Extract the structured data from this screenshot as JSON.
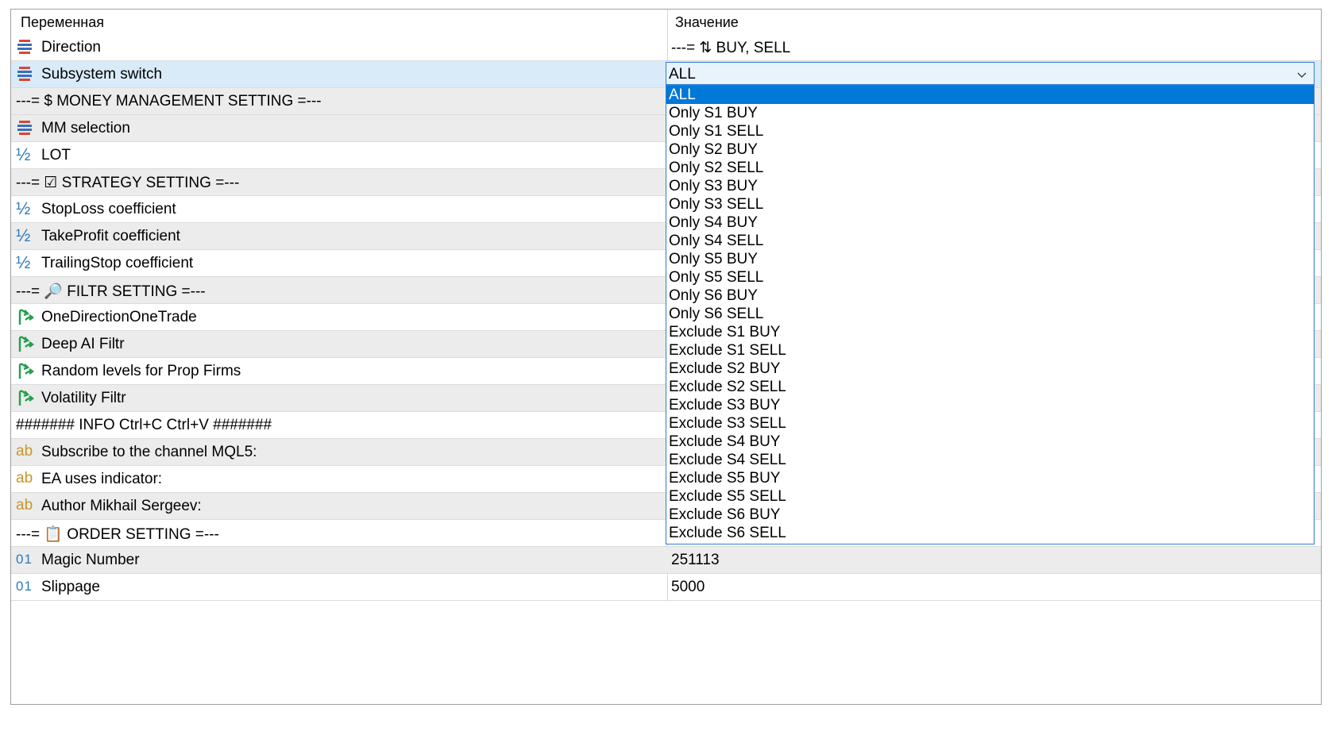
{
  "header": {
    "variable": "Переменная",
    "value": "Значение"
  },
  "rows": [
    {
      "icon": "enum",
      "name": "Direction",
      "value": "---= ⇅ BUY, SELL"
    },
    {
      "icon": "enum",
      "name": "Subsystem switch",
      "value": "ALL"
    },
    {
      "icon": "none",
      "name": "---= $ MONEY MANAGEMENT SETTING =---",
      "value": ""
    },
    {
      "icon": "enum",
      "name": "MM selection",
      "value": ""
    },
    {
      "icon": "half",
      "name": "LOT",
      "value": ""
    },
    {
      "icon": "none",
      "name": "---= ☑ STRATEGY SETTING =---",
      "value": ""
    },
    {
      "icon": "half",
      "name": "StopLoss coefficient",
      "value": ""
    },
    {
      "icon": "half",
      "name": "TakeProfit coefficient",
      "value": ""
    },
    {
      "icon": "half",
      "name": "TrailingStop coefficient",
      "value": ""
    },
    {
      "icon": "none",
      "name": "---= 🔎 FILTR SETTING =---",
      "value": ""
    },
    {
      "icon": "bool",
      "name": "OneDirectionOneTrade",
      "value": ""
    },
    {
      "icon": "bool",
      "name": "Deep AI Filtr",
      "value": ""
    },
    {
      "icon": "bool",
      "name": "Random levels for Prop Firms",
      "value": ""
    },
    {
      "icon": "bool",
      "name": "Volatility Filtr",
      "value": ""
    },
    {
      "icon": "none",
      "name": "####### INFO Ctrl+C Ctrl+V #######",
      "value": ""
    },
    {
      "icon": "ab",
      "name": "Subscribe to the channel MQL5:",
      "value": ""
    },
    {
      "icon": "ab",
      "name": "EA uses indicator:",
      "value": ""
    },
    {
      "icon": "ab",
      "name": "Author Mikhail Sergeev:",
      "value": ""
    },
    {
      "icon": "none",
      "name": "---= 📋 ORDER SETTING =---",
      "value": ""
    },
    {
      "icon": "num",
      "name": "Magic Number",
      "value": "251113"
    },
    {
      "icon": "num",
      "name": "Slippage",
      "value": "5000"
    }
  ],
  "dropdown": {
    "selected": "ALL",
    "options": [
      "ALL",
      "Only S1 BUY",
      "Only S1 SELL",
      "Only S2 BUY",
      "Only S2 SELL",
      "Only S3 BUY",
      "Only S3 SELL",
      "Only S4 BUY",
      "Only S4 SELL",
      "Only S5 BUY",
      "Only S5 SELL",
      "Only S6 BUY",
      "Only S6 SELL",
      "Exclude S1 BUY",
      "Exclude S1 SELL",
      "Exclude S2 BUY",
      "Exclude S2 SELL",
      "Exclude S3 BUY",
      "Exclude S3 SELL",
      "Exclude S4 BUY",
      "Exclude S4 SELL",
      "Exclude S5 BUY",
      "Exclude S5 SELL",
      "Exclude S6 BUY",
      "Exclude S6 SELL"
    ]
  },
  "icons": {
    "enum": "enum-list-icon",
    "half": "fraction-icon",
    "bool": "boolean-arrow-icon",
    "ab": "string-icon",
    "num": "integer-icon"
  },
  "colors": {
    "selection": "#0078d7",
    "row_selected": "#d9ebf9",
    "row_alt": "#ececec",
    "bool_icon": "#22a04a",
    "enum_icon": "#d9453a",
    "num_icon": "#2e79b9",
    "string_icon": "#c8962a"
  }
}
